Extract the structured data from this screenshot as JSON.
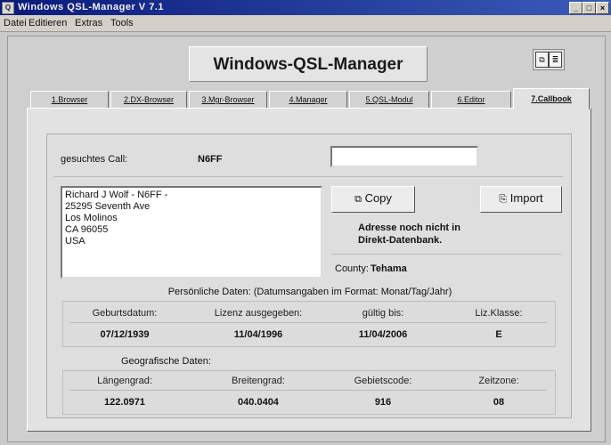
{
  "window": {
    "title": "Windows QSL-Manager V 7.1"
  },
  "menu": [
    "Datei",
    "Editieren",
    "Extras",
    "Tools"
  ],
  "header": {
    "title": "Windows-QSL-Manager",
    "icons": [
      "copy-icon",
      "list-icon"
    ]
  },
  "tabs": [
    {
      "label": "1.Browser",
      "active": false
    },
    {
      "label": "2.DX-Browser",
      "active": false
    },
    {
      "label": "3.Mgr-Browser",
      "active": false
    },
    {
      "label": "4.Manager",
      "active": false
    },
    {
      "label": "5.QSL-Modul",
      "active": false
    },
    {
      "label": "6.Editor",
      "active": false
    },
    {
      "label": "7.Callbook",
      "active": true
    }
  ],
  "callbook": {
    "search_label": "gesuchtes Call:",
    "search_call": "N6FF",
    "search_input_value": "",
    "address_lines": [
      "Richard J Wolf - N6FF -",
      "25295 Seventh Ave",
      "Los Molinos",
      "CA 96055",
      "USA"
    ],
    "copy_button": "Copy",
    "import_button": "Import",
    "status_message_line1": "Adresse noch nicht in",
    "status_message_line2": "Direkt-Datenbank.",
    "county_label": "County:",
    "county_value": "Tehama",
    "personal_title": "Persönliche Daten: (Datumsangaben im Format: Monat/Tag/Jahr)",
    "personal_headers": [
      "Geburtsdatum:",
      "Lizenz ausgegeben:",
      "gültig bis:",
      "Liz.Klasse:"
    ],
    "personal_values": [
      "07/12/1939",
      "11/04/1996",
      "11/04/2006",
      "E"
    ],
    "geo_title": "Geografische Daten:",
    "geo_headers": [
      "Längengrad:",
      "Breitengrad:",
      "Gebietscode:",
      "Zeitzone:"
    ],
    "geo_values": [
      "122.0971",
      "040.0404",
      "916",
      "08"
    ]
  }
}
